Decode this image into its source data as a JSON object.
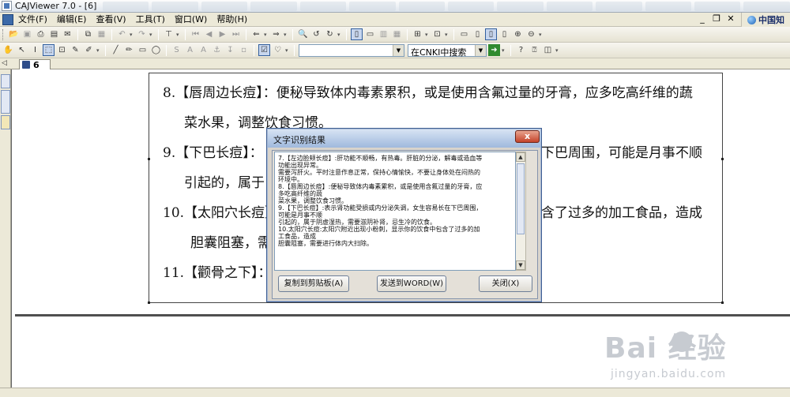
{
  "window": {
    "title": "CAJViewer 7.0 - [6]"
  },
  "menubar": {
    "items": [
      "文件(F)",
      "编辑(E)",
      "查看(V)",
      "工具(T)",
      "窗口(W)",
      "帮助(H)"
    ],
    "right_logo": "中国知"
  },
  "toolbar2": {
    "search_placeholder": "",
    "search_scope": "在CNKI中搜索"
  },
  "tab": {
    "label": "6"
  },
  "document": {
    "lines": [
      "8.【唇周边长痘】：便秘导致体内毒素累积，或是使用含氟过量的牙膏，应多吃高纤维的蔬",
      "菜水果，调整饮食习惯。",
      "9.【下巴长痘】：",
      "下巴周围，可能是月事不顺",
      "引起的，属于",
      "10.【太阳穴长痘】",
      "含了过多的加工食品，造成",
      "胆囊阻塞，需",
      "11.【颧骨之下】："
    ]
  },
  "dialog": {
    "title": "文字识别结果",
    "close_glyph": "x",
    "text_lines": [
      "7.【左边脸颊长痘】:肝功能不顺畅，有热毒。肝脏的分泌，解毒或造血等",
      "功能出现异常。",
      "需要泻肝火。平时注意作息正常，保持心情愉快，不要让身体处在闷热的",
      "环境中。",
      "8.【唇周边长痘】:便秘导致体内毒素累积，或是使用含氟过量的牙膏，应",
      "多吃高纤维的蔬",
      "菜水果，调整饮食习惯。",
      "9.【下巴长痘】:表示肾功能受损或内分泌失调，女生容易长在下巴周围，",
      "可能是月事不顺",
      "引起的，属于阴虚湿热，需要滋阴补肾，忌生冷的饮食。",
      "10.太阳穴长痘:太阳穴附近出现小粉刺，显示你的饮食中包含了过多的加",
      "工食品，造成",
      "胆囊阻塞，需要进行体内大扫除。"
    ],
    "buttons": {
      "copy": "复制到剪贴板(A)",
      "send_word": "发送到WORD(W)",
      "close": "关闭(X)"
    }
  },
  "watermark": {
    "brand": "Bai  经验",
    "url": "jingyan.baidu.com"
  }
}
